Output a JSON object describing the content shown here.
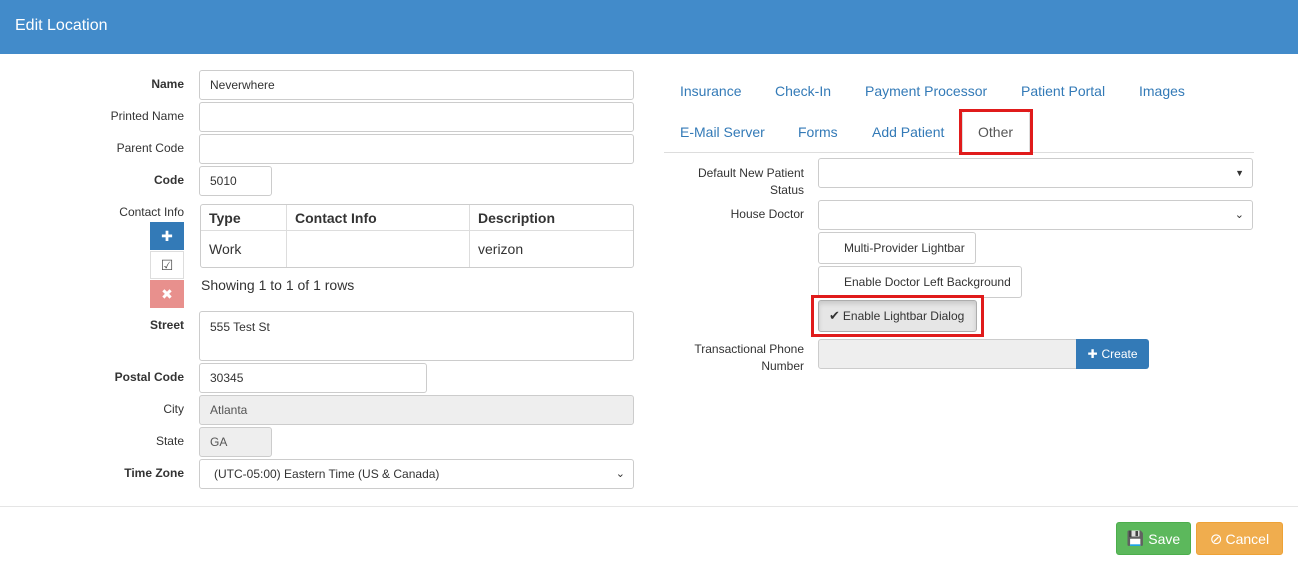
{
  "dialog": {
    "title": "Edit Location"
  },
  "form": {
    "name_label": "Name",
    "name_value": "Neverwhere",
    "printed_name_label": "Printed Name",
    "printed_name_value": "",
    "parent_code_label": "Parent Code",
    "parent_code_value": "",
    "code_label": "Code",
    "code_value": "5010",
    "contact_info_label": "Contact Info",
    "street_label": "Street",
    "street_value": "555 Test St",
    "postal_label": "Postal Code",
    "postal_value": "30345",
    "city_label": "City",
    "city_value": "Atlanta",
    "state_label": "State",
    "state_value": "GA",
    "timezone_label": "Time Zone",
    "timezone_value": "(UTC-05:00) Eastern Time (US & Canada)"
  },
  "contact_table": {
    "headers": [
      "Type",
      "Contact Info",
      "Description"
    ],
    "rows": [
      [
        "Work",
        "",
        "verizon"
      ]
    ],
    "footer": "Showing 1 to 1 of 1 rows"
  },
  "tabs": [
    "Insurance",
    "Check-In",
    "Payment Processor",
    "Patient Portal",
    "Images",
    "E-Mail Server",
    "Forms",
    "Add Patient",
    "Other"
  ],
  "active_tab": "Other",
  "other": {
    "default_status_label_1": "Default New Patient",
    "default_status_label_2": "Status",
    "default_status_value": "",
    "house_doctor_label": "House Doctor",
    "house_doctor_value": "",
    "toggles": [
      {
        "label": "Multi-Provider Lightbar",
        "active": false
      },
      {
        "label": "Enable Doctor Left Background",
        "active": false
      },
      {
        "label": "Enable Lightbar Dialog",
        "active": true
      }
    ],
    "transactional_label_1": "Transactional Phone",
    "transactional_label_2": "Number",
    "transactional_value": "",
    "create_label": "Create"
  },
  "footer": {
    "save_label": "Save",
    "cancel_label": "Cancel"
  },
  "colors": {
    "header": "#428bca",
    "highlight": "#e01b1b",
    "save": "#5cb85c",
    "cancel": "#f0ad4e",
    "danger": "#d9534f",
    "primary": "#337ab7"
  }
}
